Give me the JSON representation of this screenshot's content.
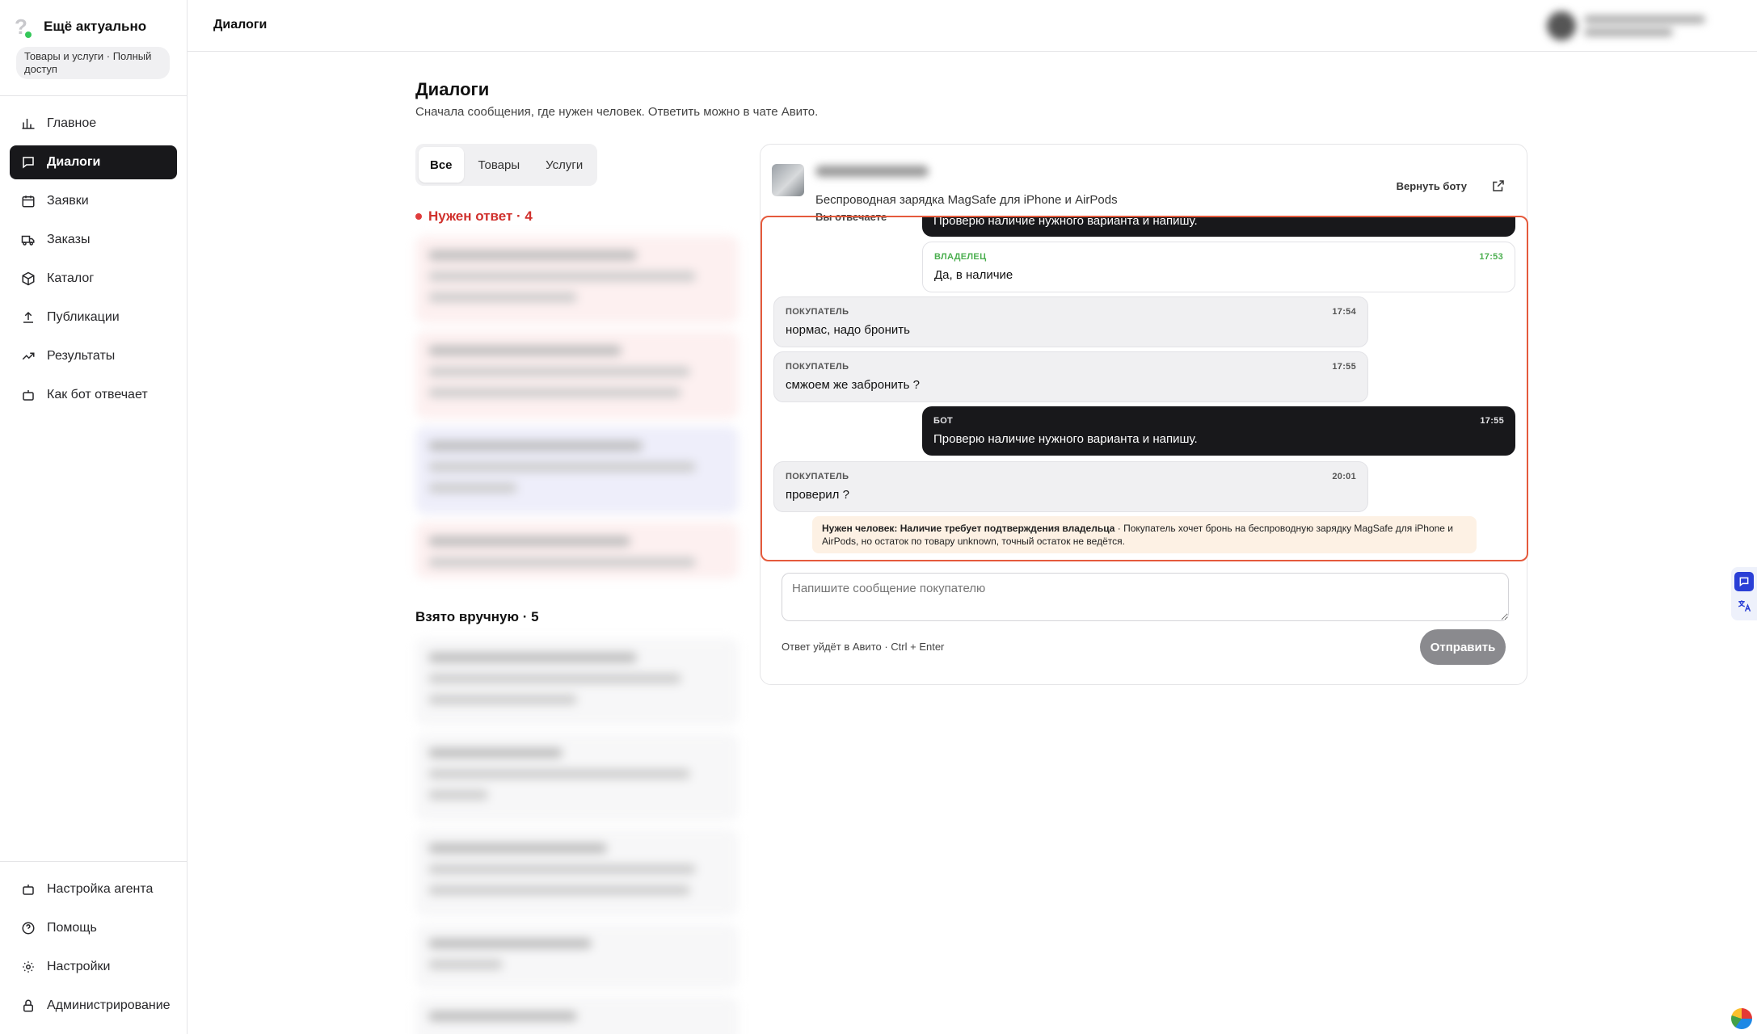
{
  "brand": {
    "title": "Ещё актуально",
    "plan": "Товары и услуги · Полный доступ"
  },
  "nav": {
    "items": [
      {
        "label": "Главное",
        "icon": "bar-chart-icon"
      },
      {
        "label": "Диалоги",
        "icon": "chat-icon",
        "active": true
      },
      {
        "label": "Заявки",
        "icon": "calendar-icon"
      },
      {
        "label": "Заказы",
        "icon": "truck-icon"
      },
      {
        "label": "Каталог",
        "icon": "box-icon"
      },
      {
        "label": "Публикации",
        "icon": "upload-icon"
      },
      {
        "label": "Результаты",
        "icon": "trending-up-icon"
      },
      {
        "label": "Как бот отвечает",
        "icon": "bot-icon"
      }
    ],
    "bottom": [
      {
        "label": "Настройка агента",
        "icon": "bot-icon"
      },
      {
        "label": "Помощь",
        "icon": "help-icon"
      },
      {
        "label": "Настройки",
        "icon": "sun-settings-icon"
      },
      {
        "label": "Администрирование",
        "icon": "lock-icon"
      }
    ]
  },
  "topbar": {
    "title": "Диалоги"
  },
  "page": {
    "title": "Диалоги",
    "subtitle": "Сначала сообщения, где нужен человек. Ответить можно в чате Авито."
  },
  "filters": {
    "tabs": [
      "Все",
      "Товары",
      "Услуги"
    ],
    "active": "Все"
  },
  "sections": {
    "needs_reply": "Нужен ответ · 4",
    "manual": "Взято вручную · 5"
  },
  "chat": {
    "listing_title": "Беспроводная зарядка MagSafe для iPhone и AirPods",
    "status": "Вы отвечаете",
    "return_bot": "Вернуть боту",
    "messages": [
      {
        "role": "bot",
        "author": "",
        "time": "",
        "text": "Проверю наличие нужного варианта и напишу."
      },
      {
        "role": "owner",
        "author": "ВЛАДЕЛЕЦ",
        "time": "17:53",
        "text": "Да, в наличие"
      },
      {
        "role": "buyer",
        "author": "ПОКУПАТЕЛЬ",
        "time": "17:54",
        "text": "нормас, надо бронить"
      },
      {
        "role": "buyer",
        "author": "ПОКУПАТЕЛЬ",
        "time": "17:55",
        "text": "смжоем же забронить ?"
      },
      {
        "role": "bot",
        "author": "БОТ",
        "time": "17:55",
        "text": "Проверю наличие нужного варианта и напишу."
      },
      {
        "role": "buyer",
        "author": "ПОКУПАТЕЛЬ",
        "time": "20:01",
        "text": "проверил ?"
      }
    ],
    "alert": {
      "title": "Нужен человек: Наличие требует подтверждения владельца",
      "body": " · Покупатель хочет бронь на беспроводную зарядку MagSafe для iPhone и AirPods, но остаток по товару unknown, точный остаток не ведётся."
    },
    "composer_placeholder": "Напишите сообщение покупателю",
    "hint": "Ответ уйдёт в Авито · Ctrl + Enter",
    "send_label": "Отправить"
  },
  "colors": {
    "accent_dark": "#18181b",
    "alert_red": "#d0312d",
    "highlight_border": "#e55a3c",
    "owner_green": "#4caf50",
    "alert_bg": "#fdf1e4"
  }
}
